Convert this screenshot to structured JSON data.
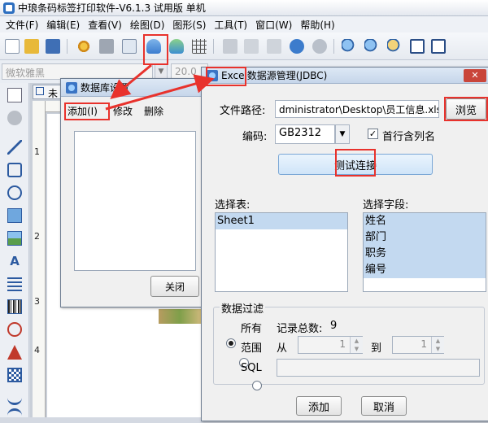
{
  "app": {
    "title": "中琅条码标签打印软件-V6.1.3 试用版 单机"
  },
  "menu": [
    "文件(F)",
    "编辑(E)",
    "查看(V)",
    "绘图(D)",
    "图形(S)",
    "工具(T)",
    "窗口(W)",
    "帮助(H)"
  ],
  "fontbar": {
    "font": "微软雅黑",
    "size": "20.0"
  },
  "doc_tab": "未",
  "ruler": [
    "1",
    "2",
    "3",
    "4"
  ],
  "colors": {
    "highlight": "#e8322c",
    "selection": "#c3d9f0",
    "title_blue": "#c6d6ea"
  },
  "toolbar_icons": [
    "new-icon",
    "open-icon",
    "save-icon",
    "settings-icon",
    "print-icon",
    "print-preview-icon",
    "database-icon",
    "database-refresh-icon",
    "grid-icon",
    "cut-icon",
    "copy-icon",
    "paste-icon",
    "undo-icon",
    "redo-icon",
    "zoom-in-icon",
    "zoom-out-icon",
    "zoom-fit-icon",
    "fit-page-icon",
    "actual-size-icon"
  ],
  "left_tools": [
    "select-tool-icon",
    "pan-tool-icon",
    "line-tool-icon",
    "rect-tool-icon",
    "ellipse-tool-icon",
    "image-tool-icon",
    "picture-tool-icon",
    "text-tool-icon",
    "multiline-text-icon",
    "barcode-tool-icon",
    "seal-tool-icon",
    "shape-tool-icon",
    "qrcode-tool-icon",
    "curve-tool-icon",
    "arc-tool-icon"
  ],
  "db_dialog": {
    "title": "数据库设置",
    "menu": [
      "添加(I)",
      "修改",
      "删除"
    ],
    "close_button": "关闭"
  },
  "excel_dialog": {
    "title": "Excel数据源管理(JDBC)",
    "file_path_label": "文件路径:",
    "file_path_value": "dministrator\\Desktop\\员工信息.xlsx",
    "browse_button": "浏览",
    "encoding_label": "编码:",
    "encoding_value": "GB2312",
    "header_checkbox_label": "首行含列名",
    "header_checked": true,
    "test_button": "测试连接",
    "tables_label": "选择表:",
    "tables": [
      "Sheet1"
    ],
    "fields_label": "选择字段:",
    "fields": [
      "姓名",
      "部门",
      "职务",
      "编号"
    ],
    "filter": {
      "group_label": "数据过滤",
      "all_label": "所有",
      "record_count_label": "记录总数:",
      "record_count": "9",
      "range_label": "范围",
      "from_label": "从",
      "from_value": "1",
      "to_label": "到",
      "to_value": "1",
      "sql_label": "SQL"
    },
    "add_button": "添加",
    "cancel_button": "取消"
  }
}
